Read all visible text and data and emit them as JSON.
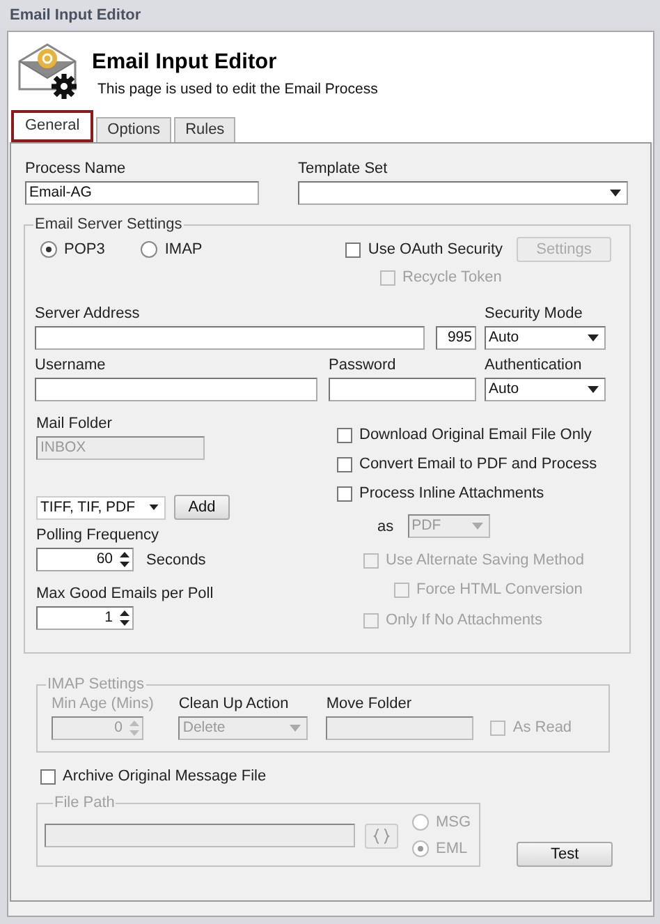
{
  "window": {
    "title": "Email Input Editor"
  },
  "header": {
    "title": "Email Input Editor",
    "subtitle": "This page is used to edit the Email Process"
  },
  "tabs": [
    {
      "label": "General",
      "selected": true
    },
    {
      "label": "Options",
      "selected": false
    },
    {
      "label": "Rules",
      "selected": false
    }
  ],
  "process_name": {
    "label": "Process Name",
    "value": "Email-AG"
  },
  "template_set": {
    "label": "Template Set"
  },
  "server": {
    "legend": "Email Server Settings",
    "protocols": [
      {
        "label": "POP3",
        "selected": true
      },
      {
        "label": "IMAP",
        "selected": false
      }
    ],
    "oauth": {
      "label": "Use OAuth Security",
      "checked": false,
      "disabled": false
    },
    "settings_button": {
      "label": "Settings",
      "disabled": true
    },
    "recycle_token": {
      "label": "Recycle Token",
      "checked": false,
      "disabled": true
    },
    "server_address": {
      "label": "Server Address"
    },
    "port": {
      "value": "995"
    },
    "security_mode": {
      "label": "Security Mode",
      "value": "Auto"
    },
    "username": {
      "label": "Username"
    },
    "password": {
      "label": "Password"
    },
    "authentication": {
      "label": "Authentication",
      "value": "Auto"
    },
    "mail_folder": {
      "label": "Mail Folder",
      "value": "INBOX",
      "disabled": true
    },
    "file_types": {
      "value": "TIFF, TIF, PDF"
    },
    "add_button": "Add",
    "polling": {
      "label": "Polling Frequency",
      "value": "60",
      "unit": "Seconds"
    },
    "max_emails": {
      "label": "Max Good Emails per Poll",
      "value": "1"
    },
    "options": [
      {
        "label": "Download Original Email File Only",
        "checked": false,
        "disabled": false
      },
      {
        "label": "Convert Email to PDF and Process",
        "checked": false,
        "disabled": false
      },
      {
        "label": "Process Inline Attachments",
        "checked": false,
        "disabled": false
      }
    ],
    "inline_as": {
      "label": "as",
      "value": "PDF",
      "disabled": true
    },
    "sub_options": [
      {
        "label": "Use Alternate Saving Method",
        "checked": false,
        "disabled": true,
        "children": [
          {
            "label": "Force HTML Conversion",
            "checked": false,
            "disabled": true
          }
        ]
      },
      {
        "label": "Only If No Attachments",
        "checked": false,
        "disabled": true
      }
    ]
  },
  "imap": {
    "legend": "IMAP Settings",
    "min_age": {
      "label": "Min Age (Mins)",
      "value": "0"
    },
    "cleanup": {
      "label": "Clean Up Action",
      "value": "Delete"
    },
    "move_folder": {
      "label": "Move Folder"
    },
    "as_read": {
      "label": "As Read",
      "checked": false,
      "disabled": true
    }
  },
  "archive": {
    "label": "Archive Original Message File",
    "checked": false,
    "disabled": false
  },
  "file_path": {
    "legend": "File Path",
    "formats": [
      {
        "label": "MSG",
        "selected": false
      },
      {
        "label": "EML",
        "selected": true
      }
    ]
  },
  "test_button": "Test"
}
